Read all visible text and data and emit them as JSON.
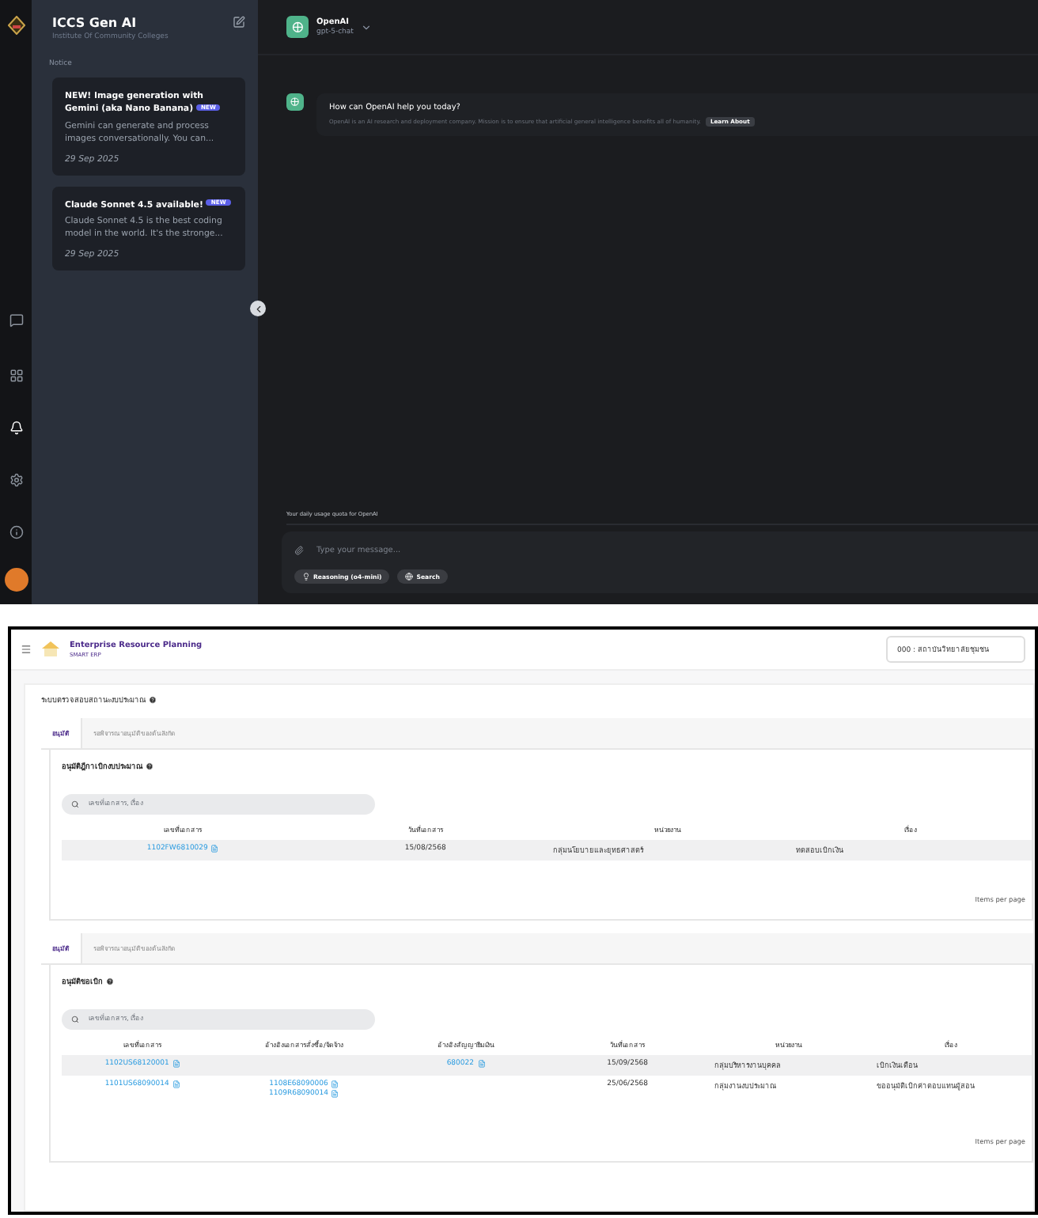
{
  "chat_app": {
    "brand": {
      "title": "ICCS Gen AI",
      "subtitle": "Institute Of Community Colleges"
    },
    "notice_label": "Notice",
    "notices": [
      {
        "title": "NEW! Image generation with Gemini (aka Nano Banana)",
        "badge": "NEW",
        "body": "Gemini can generate and process images conversationally. You can...",
        "date": "29 Sep 2025"
      },
      {
        "title": "Claude Sonnet 4.5 available!",
        "badge": "NEW",
        "body": "Claude Sonnet 4.5 is the best coding model in the world. It's the stronge...",
        "date": "29 Sep 2025"
      }
    ],
    "model": {
      "provider": "OpenAI",
      "name": "gpt-5-chat"
    },
    "greeting": {
      "title": "How can OpenAI help you today?",
      "description": "OpenAI is an AI research and deployment company. Mission is to ensure that artificial general intelligence benefits all of humanity.",
      "link": "Learn About"
    },
    "quota_note": "Your daily usage quota for OpenAI",
    "composer": {
      "placeholder": "Type your message...",
      "chips": [
        {
          "kind": "reasoning",
          "label": "Reasoning (o4-mini)"
        },
        {
          "kind": "search",
          "label": "Search"
        }
      ]
    }
  },
  "erp": {
    "header": {
      "title": "Enterprise Resource Planning",
      "subtitle": "SMART ERP",
      "unit_select": "000 : สถาบันวิทยาลัยชุมชน"
    },
    "page_title": "ระบบตรวจสอบสถานะงบประมาณ",
    "panels": [
      {
        "tabs": [
          {
            "label": "อนุมัติ",
            "selected": true
          },
          {
            "label": "รอพิจารณาอนุมัติของต้นสังกัด",
            "selected": false
          }
        ],
        "section_title": "อนุมัติฎีกาเบิกงบประมาณ",
        "search_placeholder": "เลขที่เอกสาร, เรื่อง",
        "columns": [
          "เลขที่เอกสาร",
          "วันที่เอกสาร",
          "หน่วยงาน",
          "เรื่อง"
        ],
        "rows": [
          [
            {
              "kind": "links",
              "values": [
                "1102FW6810029"
              ]
            },
            {
              "kind": "text",
              "value": "15/08/2568"
            },
            {
              "kind": "text",
              "value": "กลุ่มนโยบายและยุทธศาสตร์"
            },
            {
              "kind": "text",
              "value": "ทดสอบเบิกเงิน"
            }
          ]
        ],
        "pagination_label": "Items per page"
      },
      {
        "tabs": [
          {
            "label": "อนุมัติ",
            "selected": true
          },
          {
            "label": "รอพิจารณาอนุมัติของต้นสังกัด",
            "selected": false
          }
        ],
        "section_title": "อนุมัติขอเบิก",
        "search_placeholder": "เลขที่เอกสาร, เรื่อง",
        "columns": [
          "เลขที่เอกสาร",
          "อ้างอิงเอกสารสั่งซื้อ/จัดจ้าง",
          "อ้างอิงสัญญายืมเงิน",
          "วันที่เอกสาร",
          "หน่วยงาน",
          "เรื่อง"
        ],
        "rows": [
          [
            {
              "kind": "links",
              "values": [
                "1102US68120001"
              ]
            },
            {
              "kind": "empty"
            },
            {
              "kind": "links",
              "values": [
                "680022"
              ]
            },
            {
              "kind": "text",
              "value": "15/09/2568"
            },
            {
              "kind": "text",
              "value": "กลุ่มบริหารงานบุคคล"
            },
            {
              "kind": "text",
              "value": "เบิกเงินเดือน"
            }
          ],
          [
            {
              "kind": "links",
              "values": [
                "1101US68090014"
              ]
            },
            {
              "kind": "links",
              "values": [
                "1108E68090006",
                "1109R68090014"
              ]
            },
            {
              "kind": "empty"
            },
            {
              "kind": "text",
              "value": "25/06/2568"
            },
            {
              "kind": "text",
              "value": "กลุ่มงานงบประมาณ"
            },
            {
              "kind": "text",
              "value": "ขออนุมัติเบิกค่าตอบแทนผู้สอน"
            }
          ]
        ],
        "pagination_label": "Items per page"
      }
    ]
  }
}
